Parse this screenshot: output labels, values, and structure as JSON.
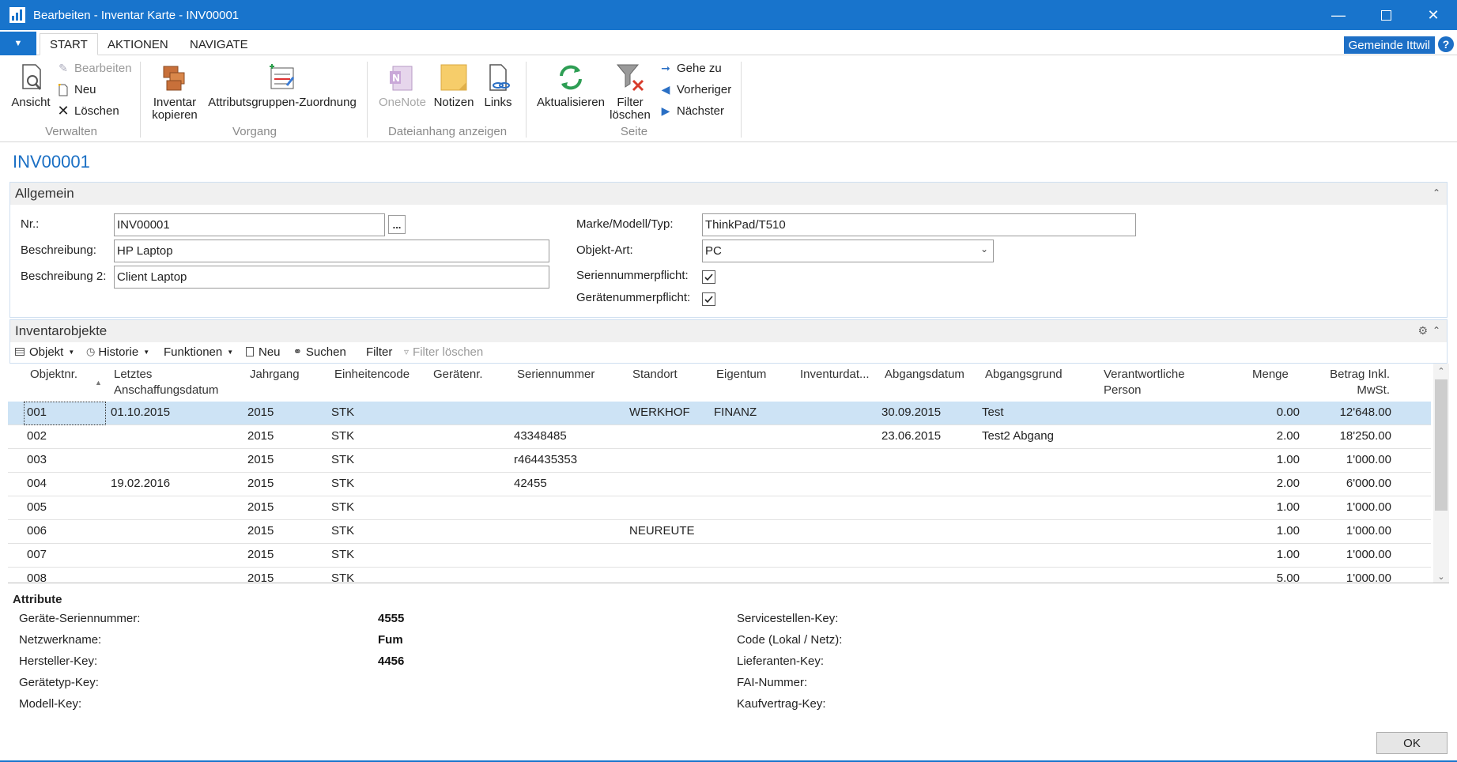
{
  "window": {
    "title": "Bearbeiten - Inventar Karte - INV00001"
  },
  "ribbon_tabs": [
    "START",
    "AKTIONEN",
    "NAVIGATE"
  ],
  "company": "Gemeinde Ittwil",
  "help_label": "?",
  "ribbon": {
    "verwalten": {
      "group": "Verwalten",
      "ansicht": "Ansicht",
      "bearbeiten": "Bearbeiten",
      "neu": "Neu",
      "loeschen": "Löschen"
    },
    "vorgang": {
      "group": "Vorgang",
      "inventar_kopieren_1": "Inventar",
      "inventar_kopieren_2": "kopieren",
      "attributgruppen": "Attributsgruppen-Zuordnung"
    },
    "dateianhang": {
      "group": "Dateianhang anzeigen",
      "onenote": "OneNote",
      "notizen": "Notizen",
      "links": "Links"
    },
    "seite": {
      "group": "Seite",
      "aktualisieren": "Aktualisieren",
      "filter_loeschen_1": "Filter",
      "filter_loeschen_2": "löschen",
      "gehe_zu": "Gehe zu",
      "vorheriger": "Vorheriger",
      "naechster": "Nächster"
    }
  },
  "page_title": "INV00001",
  "allgemein": {
    "header": "Allgemein",
    "nr_label": "Nr.:",
    "nr_value": "INV00001",
    "assist_label": "...",
    "beschreibung_label": "Beschreibung:",
    "beschreibung_value": "HP Laptop",
    "beschreibung2_label": "Beschreibung 2:",
    "beschreibung2_value": "Client Laptop",
    "marke_label": "Marke/Modell/Typ:",
    "marke_value": "ThinkPad/T510",
    "objektart_label": "Objekt-Art:",
    "objektart_value": "PC",
    "seriennummerpflicht_label": "Seriennummerpflicht:",
    "seriennummerpflicht_checked": true,
    "geraetenummerpflicht_label": "Gerätenummerpflicht:",
    "geraetenummerpflicht_checked": true
  },
  "inventarobjekte": {
    "header": "Inventarobjekte",
    "toolbar": {
      "objekt": "Objekt",
      "historie": "Historie",
      "funktionen": "Funktionen",
      "neu": "Neu",
      "suchen": "Suchen",
      "filter": "Filter",
      "filter_loeschen": "Filter löschen"
    },
    "columns": {
      "objektnr": "Objektnr.",
      "letztes_1": "Letztes",
      "letztes_2": "Anschaffungsdatum",
      "jahrgang": "Jahrgang",
      "einheitencode": "Einheitencode",
      "geraetenr": "Gerätenr.",
      "seriennummer": "Seriennummer",
      "standort": "Standort",
      "eigentum": "Eigentum",
      "inventurdat": "Inventurdat...",
      "abgangsdatum": "Abgangsdatum",
      "abgangsgrund": "Abgangsgrund",
      "verantw_1": "Verantwortliche",
      "verantw_2": "Person",
      "menge": "Menge",
      "betrag_1": "Betrag Inkl.",
      "betrag_2": "MwSt."
    },
    "rows": [
      {
        "objektnr": "001",
        "anschaffung": "01.10.2015",
        "jahrgang": "2015",
        "einheit": "STK",
        "serien": "",
        "standort": "WERKHOF",
        "eigentum": "FINANZ",
        "abgangsdatum": "30.09.2015",
        "abgangsgrund": "Test",
        "menge": "0.00",
        "betrag": "12'648.00"
      },
      {
        "objektnr": "002",
        "anschaffung": "",
        "jahrgang": "2015",
        "einheit": "STK",
        "serien": "43348485",
        "standort": "",
        "eigentum": "",
        "abgangsdatum": "23.06.2015",
        "abgangsgrund": "Test2 Abgang",
        "menge": "2.00",
        "betrag": "18'250.00"
      },
      {
        "objektnr": "003",
        "anschaffung": "",
        "jahrgang": "2015",
        "einheit": "STK",
        "serien": "r464435353",
        "standort": "",
        "eigentum": "",
        "abgangsdatum": "",
        "abgangsgrund": "",
        "menge": "1.00",
        "betrag": "1'000.00"
      },
      {
        "objektnr": "004",
        "anschaffung": "19.02.2016",
        "jahrgang": "2015",
        "einheit": "STK",
        "serien": "42455",
        "standort": "",
        "eigentum": "",
        "abgangsdatum": "",
        "abgangsgrund": "",
        "menge": "2.00",
        "betrag": "6'000.00"
      },
      {
        "objektnr": "005",
        "anschaffung": "",
        "jahrgang": "2015",
        "einheit": "STK",
        "serien": "",
        "standort": "",
        "eigentum": "",
        "abgangsdatum": "",
        "abgangsgrund": "",
        "menge": "1.00",
        "betrag": "1'000.00"
      },
      {
        "objektnr": "006",
        "anschaffung": "",
        "jahrgang": "2015",
        "einheit": "STK",
        "serien": "",
        "standort": "NEUREUTE",
        "eigentum": "",
        "abgangsdatum": "",
        "abgangsgrund": "",
        "menge": "1.00",
        "betrag": "1'000.00"
      },
      {
        "objektnr": "007",
        "anschaffung": "",
        "jahrgang": "2015",
        "einheit": "STK",
        "serien": "",
        "standort": "",
        "eigentum": "",
        "abgangsdatum": "",
        "abgangsgrund": "",
        "menge": "1.00",
        "betrag": "1'000.00"
      },
      {
        "objektnr": "008",
        "anschaffung": "",
        "jahrgang": "2015",
        "einheit": "STK",
        "serien": "",
        "standort": "",
        "eigentum": "",
        "abgangsdatum": "",
        "abgangsgrund": "",
        "menge": "5.00",
        "betrag": "1'000.00"
      }
    ]
  },
  "attribute": {
    "title": "Attribute",
    "left": [
      {
        "label": "Geräte-Seriennummer:",
        "value": "4555"
      },
      {
        "label": "Netzwerkname:",
        "value": "Fum"
      },
      {
        "label": "Hersteller-Key:",
        "value": "4456"
      },
      {
        "label": "Gerätetyp-Key:",
        "value": ""
      },
      {
        "label": "Modell-Key:",
        "value": ""
      }
    ],
    "right": [
      {
        "label": "Servicestellen-Key:",
        "value": ""
      },
      {
        "label": "Code (Lokal / Netz):",
        "value": ""
      },
      {
        "label": "Lieferanten-Key:",
        "value": ""
      },
      {
        "label": "FAI-Nummer:",
        "value": ""
      },
      {
        "label": "Kaufvertrag-Key:",
        "value": ""
      }
    ]
  },
  "ok_label": "OK",
  "colors": {
    "accent": "#1874cc",
    "selection": "#cde3f5"
  }
}
